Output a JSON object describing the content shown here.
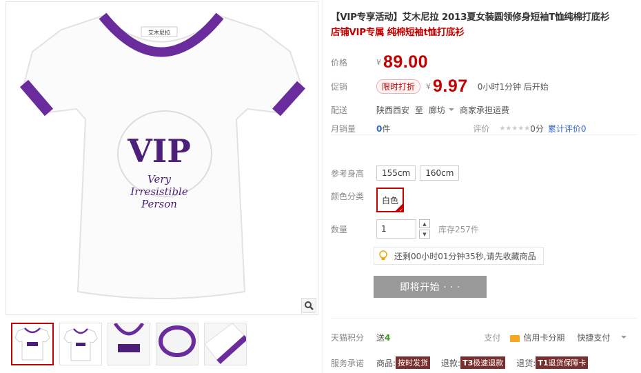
{
  "product": {
    "title": "【VIP专享活动】艾木尼拉 2013夏女装圆领修身短袖T恤纯棉打底衫",
    "subtitle": "店铺VIP专属 纯棉短袖t恤打底衫"
  },
  "price": {
    "label": "价格",
    "currency": "¥",
    "value": "89.00"
  },
  "promo": {
    "label": "促销",
    "tag": "限时打折",
    "currency": "¥",
    "value": "9.97",
    "countdown": "0小时1分钟 后开始"
  },
  "shipping": {
    "label": "配送",
    "from": "陕西西安",
    "to_word": "至",
    "dest": "廊坊",
    "note": "商家承担运费"
  },
  "sales": {
    "label": "月销量",
    "count": "0",
    "unit": "件",
    "review_label": "评价",
    "stars": "★★★★★",
    "score": "0分",
    "reviews_text": "累计评价",
    "reviews": "0"
  },
  "options": {
    "height_label": "参考身高",
    "heights": [
      "155cm",
      "160cm"
    ],
    "color_label": "颜色分类",
    "colors": [
      "白色"
    ],
    "qty_label": "数量",
    "qty_value": "1",
    "stock": "库存257件",
    "tip": "还剩00小时01分钟35秒,请先收藏商品",
    "start_button": "即将开始 · · ·"
  },
  "footer": {
    "points_label": "天猫积分",
    "points_prefix": "送",
    "points_value": "4",
    "pay_label": "支付",
    "pay_card": "信用卡分期",
    "pay_quick": "快捷支付",
    "service_label": "服务承诺",
    "svc1_label": "商品:",
    "svc1_badge": "按时发货",
    "svc2_label": "退款:",
    "svc2_code": "T3",
    "svc2_badge": "极速退款",
    "svc3_label": "退货:",
    "svc3_code": "T1",
    "svc3_badge": "退货保障卡"
  },
  "image": {
    "shirt_text_1": "VIP",
    "shirt_text_2": "Very",
    "shirt_text_3": "Irresistible",
    "shirt_text_4": "Person",
    "collar_label": "艾木尼拉"
  },
  "colors": {
    "accent": "#c40000",
    "purple": "#6a2c9c",
    "button_gray": "#999999",
    "link_blue": "#3366cc"
  }
}
